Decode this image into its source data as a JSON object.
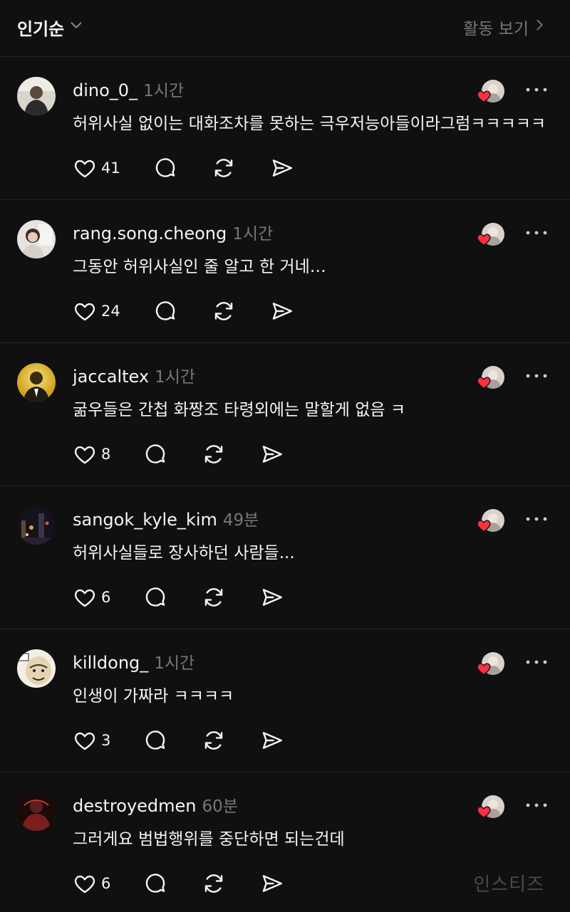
{
  "header": {
    "sort_label": "인기순",
    "activity_label": "활동 보기"
  },
  "comments": [
    {
      "username": "dino_0_",
      "time": "1시간",
      "text": "허위사실 없이는 대화조차를 못하는 극우저능아들이라그럼ㅋㅋㅋㅋㅋ",
      "likes": "41"
    },
    {
      "username": "rang.song.cheong",
      "time": "1시간",
      "text": "그동안 허위사실인 줄 알고 한 거네…",
      "likes": "24"
    },
    {
      "username": "jaccaltex",
      "time": "1시간",
      "text": "굶우들은 간첩 화짱조 타령외에는 말할게 없음 ㅋ",
      "likes": "8"
    },
    {
      "username": "sangok_kyle_kim",
      "time": "49분",
      "text": "허위사실들로 장사하던 사람들...",
      "likes": "6"
    },
    {
      "username": "killdong_",
      "time": "1시간",
      "text": "인생이 가짜라 ㅋㅋㅋㅋ",
      "likes": "3"
    },
    {
      "username": "destroyedmen",
      "time": "60분",
      "text": "그러게요 범법행위를 중단하면 되는건데",
      "likes": "6"
    }
  ],
  "watermark": "인스티즈",
  "colors": {
    "background": "#101010",
    "text": "#f3f5f7",
    "secondary": "#777777",
    "divider": "#262626",
    "heart": "#ff3040"
  },
  "icons": [
    "chevron-down-icon",
    "chevron-right-icon",
    "heart-icon",
    "reply-icon",
    "repost-icon",
    "share-icon",
    "more-icon"
  ]
}
